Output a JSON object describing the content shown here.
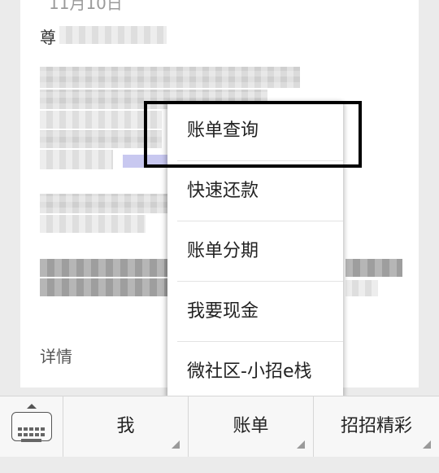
{
  "message": {
    "date_partial": "11月10日",
    "greeting_partial": "尊",
    "details_label": "详情"
  },
  "menu": {
    "items": [
      {
        "label": "账单查询"
      },
      {
        "label": "快速还款"
      },
      {
        "label": "账单分期"
      },
      {
        "label": "我要现金"
      },
      {
        "label": "微社区-小招e栈"
      }
    ]
  },
  "tabbar": {
    "tabs": [
      {
        "label": "我"
      },
      {
        "label": "账单"
      },
      {
        "label": "招招精彩"
      }
    ]
  },
  "icons": {
    "keyboard": "keyboard-icon"
  }
}
